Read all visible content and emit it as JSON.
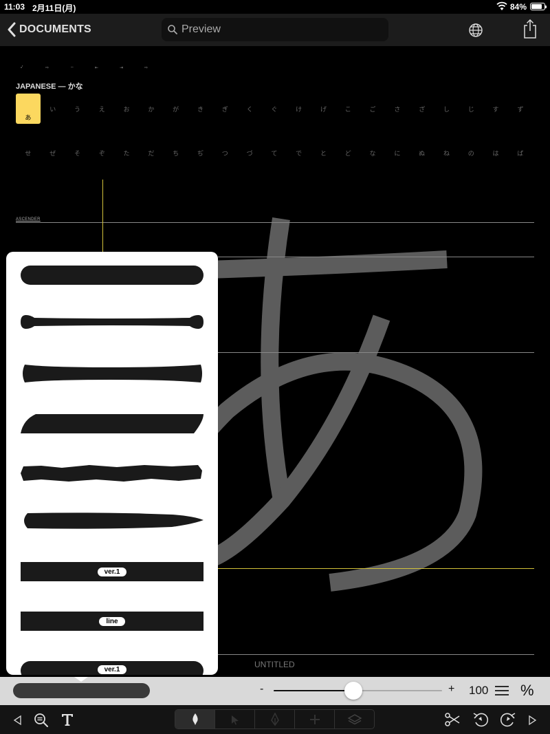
{
  "status": {
    "time": "11:03",
    "date": "2月11日(月)",
    "battery": "84%",
    "battery_level": 0.84
  },
  "nav": {
    "back_label": "DOCUMENTS",
    "search_placeholder": "Preview"
  },
  "canvas": {
    "tiny_icons": [
      "⤦",
      "⇨",
      "⇔",
      "⇤",
      "⇥",
      "⇨"
    ],
    "section_title": "JAPANESE — かな",
    "chars_row1": [
      "あ",
      "い",
      "う",
      "え",
      "お",
      "か",
      "が",
      "き",
      "ぎ",
      "く",
      "ぐ",
      "け",
      "げ",
      "こ",
      "ご",
      "さ",
      "ざ",
      "し",
      "じ",
      "す",
      "ず"
    ],
    "chars_row2": [
      "せ",
      "ぜ",
      "そ",
      "ぞ",
      "た",
      "だ",
      "ち",
      "ぢ",
      "つ",
      "づ",
      "て",
      "で",
      "と",
      "ど",
      "な",
      "に",
      "ぬ",
      "ね",
      "の",
      "は",
      "ば"
    ],
    "selected_char": "あ",
    "guide_label": "ASCENDER",
    "doc_name": "UNTITLED"
  },
  "brushes": {
    "tag_1": "ver.1",
    "tag_2": "line",
    "tag_3": "ver.1"
  },
  "slider": {
    "minus": "-",
    "plus": "+",
    "value_text": "100",
    "value_fraction": 0.47,
    "percent": "%"
  },
  "colors": {
    "accent_yellow": "#fcd85f",
    "guide_yellow": "#d4c33a",
    "glyph_gray": "#5c5c5c"
  },
  "toolbar": {
    "icons": [
      "prev-arrow-icon",
      "zoom-icon",
      "text-icon",
      "brush-tool-icon",
      "select-tool-icon",
      "pen-tool-icon",
      "add-point-icon",
      "layers-icon",
      "scissors-icon",
      "undo-icon",
      "redo-icon",
      "next-arrow-icon"
    ]
  }
}
